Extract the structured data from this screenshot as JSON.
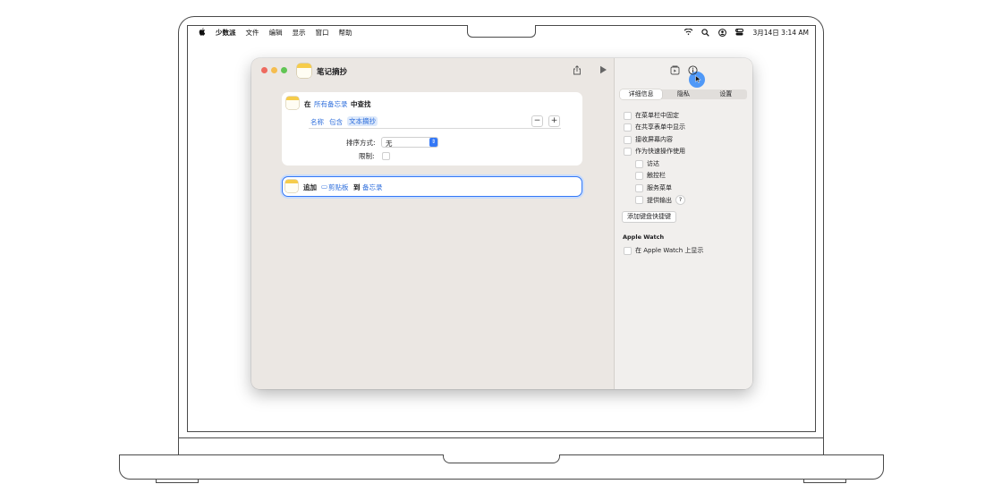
{
  "menubar": {
    "apple": "",
    "app_name": "少数派",
    "menus": [
      "文件",
      "编辑",
      "显示",
      "窗口",
      "帮助"
    ],
    "clock": "3月14日  3:14 AM",
    "status_icons": [
      "wifi-icon",
      "search-icon",
      "user-icon",
      "control-center-icon"
    ]
  },
  "window": {
    "title": "笔记摘抄",
    "app_icon": "notes-icon"
  },
  "action1": {
    "prefix": "在",
    "scope": "所有备忘录",
    "suffix": "中查找",
    "filter": {
      "field": "名称",
      "op": "包含",
      "value": "文本摘抄"
    },
    "sort_label": "排序方式:",
    "sort_value": "无",
    "limit_label": "限制:"
  },
  "action2": {
    "verb": "追加",
    "source": "剪贴板",
    "source_icon": "clipboard-icon",
    "to": "到",
    "target": "备忘录"
  },
  "inspector": {
    "tabs": [
      "详细信息",
      "隐私",
      "设置"
    ],
    "active_tab": 0,
    "options": [
      "在菜单栏中固定",
      "在共享表单中显示",
      "接收屏幕内容",
      "作为快速操作使用"
    ],
    "sub_options": [
      "访达",
      "触控栏",
      "服务菜单",
      "提供输出"
    ],
    "help_label": "?",
    "shortcut_button": "添加键盘快捷键",
    "watch_heading": "Apple Watch",
    "watch_option": "在 Apple Watch 上显示"
  },
  "colors": {
    "accent": "#3478f6",
    "token_bg": "#dde9fb",
    "window_bg": "#ebe7e3"
  }
}
